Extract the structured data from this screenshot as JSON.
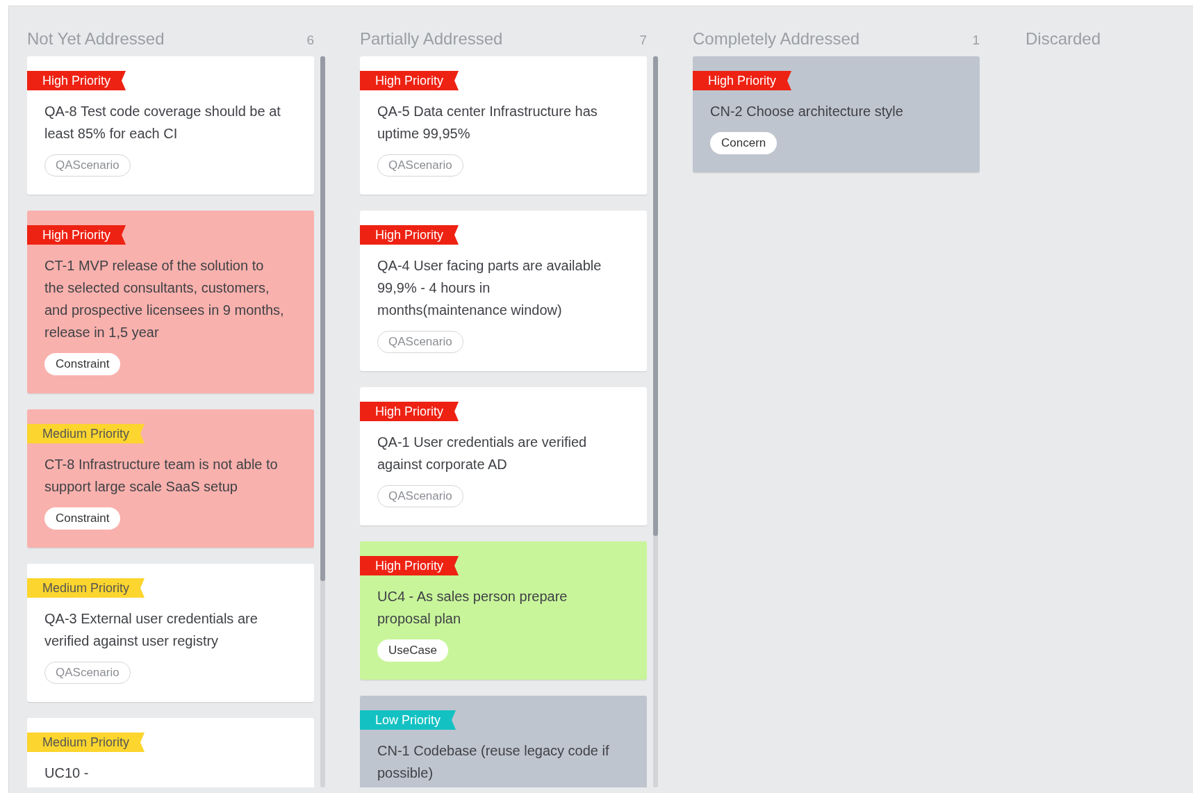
{
  "columns": [
    {
      "title": "Not Yet Addressed",
      "count": "6",
      "cards": [
        {
          "kind": "high",
          "priority_label": "High Priority",
          "color": "#ffffff",
          "text": "QA-8 Test code coverage should be at least 85% for each CI",
          "tag": "QAScenario",
          "tag_outlined": true
        },
        {
          "kind": "high",
          "priority_label": "High Priority",
          "color": "#f9b1ad",
          "text": "CT-1 MVP release of the solution to the selected consultants, customers, and prospective licensees in 9 months, release in 1,5 year",
          "tag": "Constraint",
          "tag_outlined": false
        },
        {
          "kind": "medium",
          "priority_label": "Medium Priority",
          "color": "#f9b1ad",
          "text": "CT-8 Infrastructure team is not able to support large scale SaaS setup",
          "tag": "Constraint",
          "tag_outlined": false
        },
        {
          "kind": "medium",
          "priority_label": "Medium Priority",
          "color": "#ffffff",
          "text": "QA-3 External user credentials are verified against user registry",
          "tag": "QAScenario",
          "tag_outlined": true
        },
        {
          "kind": "medium",
          "priority_label": "Medium Priority",
          "color": "#ffffff",
          "text": "UC10 -"
        }
      ]
    },
    {
      "title": "Partially Addressed",
      "count": "7",
      "cards": [
        {
          "kind": "high",
          "priority_label": "High Priority",
          "color": "#ffffff",
          "text": "QA-5 Data center Infrastructure has uptime 99,95%",
          "tag": "QAScenario",
          "tag_outlined": true
        },
        {
          "kind": "high",
          "priority_label": "High Priority",
          "color": "#ffffff",
          "text": "QA-4 User facing parts are available 99,9% - 4 hours in months(maintenance window)",
          "tag": "QAScenario",
          "tag_outlined": true
        },
        {
          "kind": "high",
          "priority_label": "High Priority",
          "color": "#ffffff",
          "text": "QA-1 User credentials are verified against corporate AD",
          "tag": "QAScenario",
          "tag_outlined": true
        },
        {
          "kind": "high",
          "priority_label": "High Priority",
          "color": "#c8f59a",
          "text": "UC4 - As sales person prepare proposal plan",
          "tag": "UseCase",
          "tag_outlined": false
        },
        {
          "kind": "low",
          "priority_label": "Low Priority",
          "color": "#bfc5cf",
          "text": "CN-1 Codebase (reuse legacy code if possible)"
        }
      ]
    },
    {
      "title": "Completely Addressed",
      "count": "1",
      "cards": [
        {
          "kind": "high",
          "priority_label": "High Priority",
          "color": "#bfc5cf",
          "text": "CN-2 Choose architecture style",
          "tag": "Concern",
          "tag_outlined": false
        }
      ]
    },
    {
      "title": "Discarded"
    }
  ]
}
